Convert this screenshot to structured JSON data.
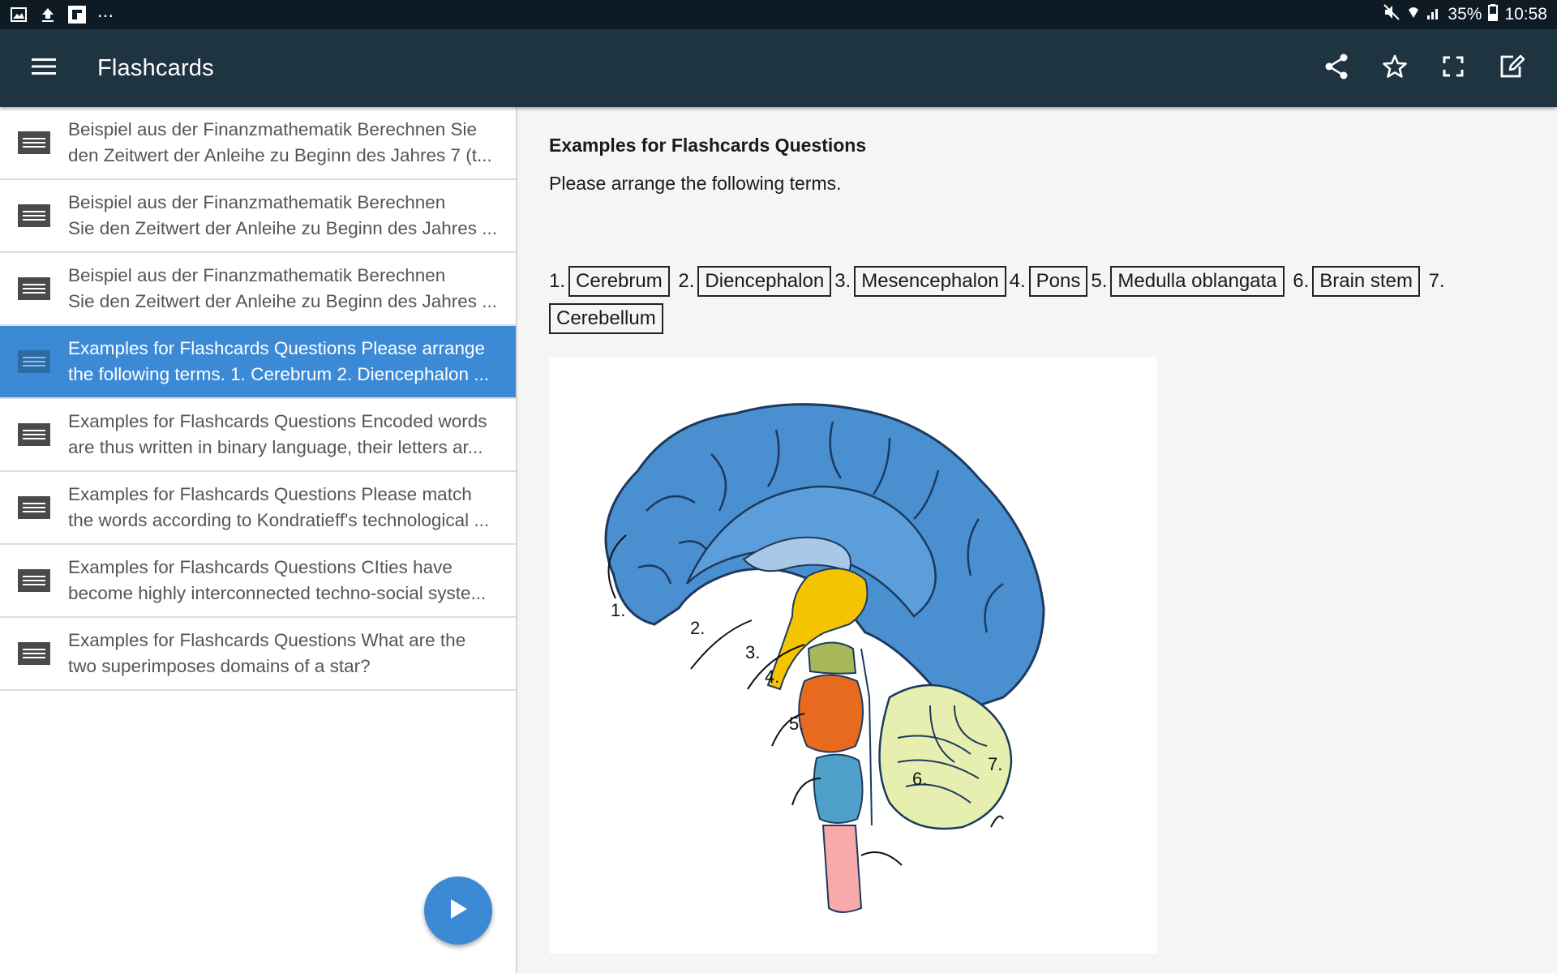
{
  "status_bar": {
    "battery": "35%",
    "time": "10:58",
    "more": "..."
  },
  "app_bar": {
    "title": "Flashcards",
    "icons": [
      "menu-icon",
      "share-icon",
      "star-icon",
      "fullscreen-icon",
      "edit-icon"
    ]
  },
  "list": {
    "items": [
      {
        "line1": "Beispiel aus der Finanzmathematik Berechnen Sie",
        "line2": "den Zeitwert der Anleihe zu Beginn des Jahres 7 (t..."
      },
      {
        "line1": "Beispiel aus der Finanzmathematik Berechnen",
        "line2": "Sie den Zeitwert der Anleihe zu Beginn des Jahres ..."
      },
      {
        "line1": "Beispiel aus der Finanzmathematik Berechnen",
        "line2": "Sie den Zeitwert der Anleihe zu Beginn des Jahres ..."
      },
      {
        "line1": "Examples for Flashcards Questions Please arrange",
        "line2": "the following terms. 1. Cerebrum 2. Diencephalon ...",
        "selected": true
      },
      {
        "line1": "Examples for Flashcards Questions Encoded words",
        "line2": "are thus written in binary language, their letters ar..."
      },
      {
        "line1": "Examples for Flashcards Questions Please match",
        "line2": "the words according to Kondratieff's technological ..."
      },
      {
        "line1": "Examples for Flashcards Questions CIties have",
        "line2": "become highly interconnected techno-social syste..."
      },
      {
        "line1": "Examples for Flashcards Questions What are the",
        "line2": "two superimposes domains of a star?"
      }
    ],
    "selected_color": "#3c8ad6"
  },
  "content": {
    "title": "Examples for Flashcards Questions",
    "prompt": "Please arrange the following terms.",
    "terms": [
      {
        "num": "1.",
        "term": "Cerebrum"
      },
      {
        "num": "2.",
        "term": "Diencephalon"
      },
      {
        "num": "3.",
        "term": "Mesencephalon"
      },
      {
        "num": "4.",
        "term": "Pons"
      },
      {
        "num": "5.",
        "term": "Medulla oblangata"
      },
      {
        "num": "6.",
        "term": "Brain stem"
      },
      {
        "num": "7.",
        "term": "Cerebellum"
      }
    ],
    "figure_labels": [
      "1.",
      "2.",
      "3.",
      "4.",
      "5.",
      "6.",
      "7."
    ]
  }
}
